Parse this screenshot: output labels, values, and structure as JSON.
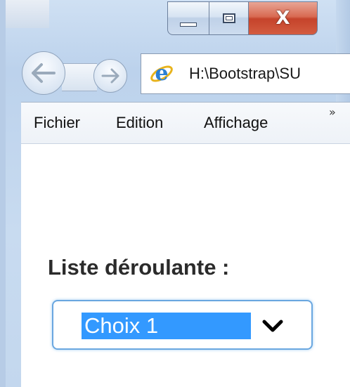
{
  "window": {
    "close_glyph": "X"
  },
  "navigation": {
    "back_icon": "back-arrow-icon",
    "forward_icon": "forward-arrow-icon"
  },
  "address_bar": {
    "icon": "ie-icon",
    "value": "H:\\Bootstrap\\SU"
  },
  "menu": {
    "items": [
      "Fichier",
      "Edition",
      "Affichage"
    ],
    "more_glyph": "»"
  },
  "form": {
    "label": "Liste déroulante :",
    "select": {
      "selected": "Choix 1",
      "icon": "chevron-down-icon"
    }
  },
  "colors": {
    "selection": "#3399ff",
    "focus_border": "#6aa7e0",
    "close_button": "#c5432b"
  }
}
